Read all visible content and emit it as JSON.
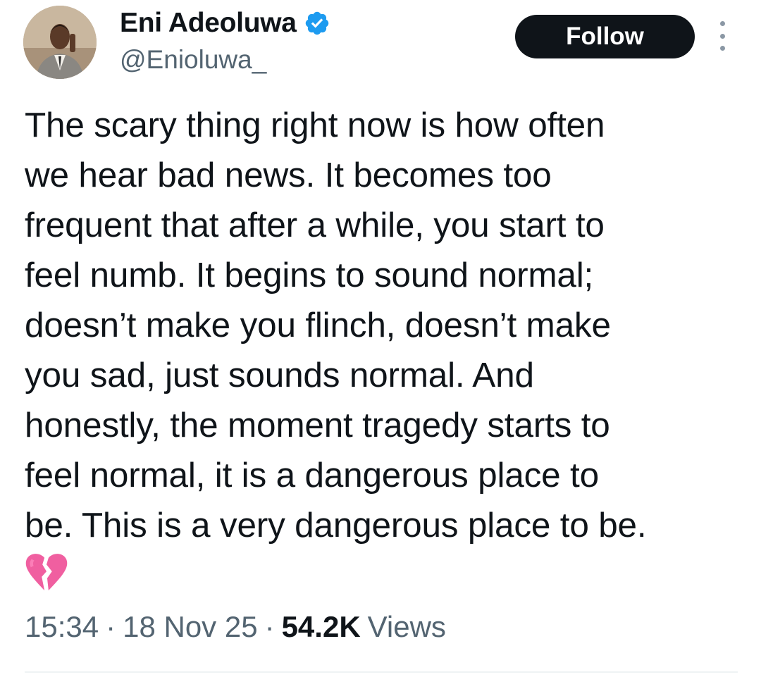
{
  "author": {
    "display_name": "Eni Adeoluwa",
    "handle": "@Enioluwa_",
    "verified": true,
    "verified_color": "#1d9bf0",
    "avatar_icon": "profile-photo"
  },
  "actions": {
    "follow_label": "Follow",
    "more_icon": "vertical-ellipsis"
  },
  "tweet": {
    "text": "The scary thing right now is how often\nwe hear bad news.  It becomes too\nfrequent that after a while, you start to\nfeel numb. It begins to sound normal;\ndoesn’t make you flinch, doesn’t make\nyou sad, just sounds normal. And\nhonestly, the moment tragedy starts to\nfeel normal, it is a dangerous place to\nbe. This is a very dangerous place to be.",
    "emoji": "broken-heart"
  },
  "meta": {
    "time": "15:34",
    "separator": "·",
    "date": "18 Nov 25",
    "views_count": "54.2K",
    "views_label": "Views"
  },
  "colors": {
    "text": "#0f1419",
    "secondary": "#536471",
    "button_bg": "#0f1419",
    "emoji": "#f05fa0"
  }
}
